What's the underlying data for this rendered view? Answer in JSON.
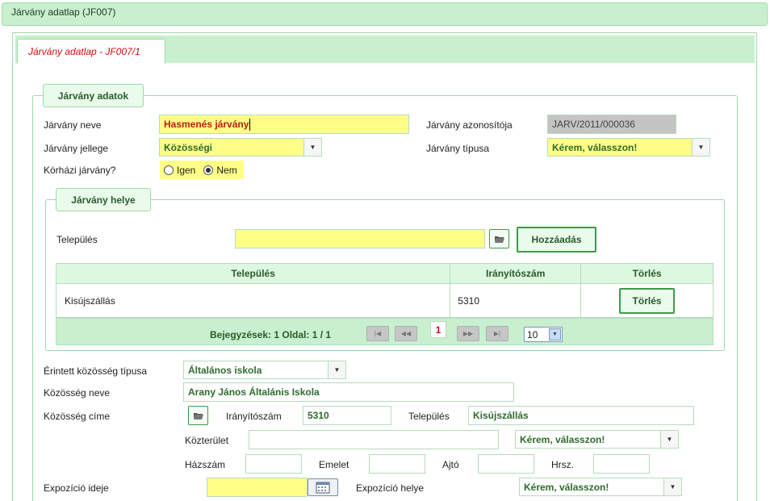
{
  "window_title": "Járvány adatlap (JF007)",
  "tab": {
    "label": "Járvány adatlap - JF007/1"
  },
  "section_main": {
    "legend": "Járvány adatok",
    "name_label": "Járvány neve",
    "name_value": "Hasmenés járvány",
    "id_label": "Járvány azonosítója",
    "id_value": "JARV/2011/000036",
    "character_label": "Járvány jellege",
    "character_value": "Közösségi",
    "type_label": "Járvány típusa",
    "type_value": "Kérem, válasszon!",
    "hospital_label": "Kórházi járvány?",
    "hospital_yes": "Igen",
    "hospital_no": "Nem",
    "hospital_selected": "Nem"
  },
  "section_location": {
    "legend": "Járvány helye",
    "settlement_label": "Település",
    "settlement_value": "",
    "add_button": "Hozzáadás",
    "table": {
      "headers": [
        "Település",
        "Irányítószám",
        "Törlés"
      ],
      "rows": [
        {
          "settlement": "Kisújszállás",
          "zip": "5310",
          "delete": "Törlés"
        }
      ]
    },
    "pager": {
      "info": "Bejegyzések: 1 Oldal: 1 / 1",
      "current_page": "1",
      "page_size": "10"
    }
  },
  "community": {
    "type_label": "Érintett közösség típusa",
    "type_value": "Általános iskola",
    "name_label": "Közösség neve",
    "name_value": "Arany János Általánis Iskola",
    "address_label": "Közösség címe",
    "zip_label": "Irányítószám",
    "zip_value": "5310",
    "city_label": "Település",
    "city_value": "Kisújszállás",
    "street_label": "Közterület",
    "street_value": "",
    "street_type_value": "Kérem, válasszon!",
    "house_label": "Házszám",
    "floor_label": "Emelet",
    "door_label": "Ajtó",
    "lot_label": "Hrsz."
  },
  "exposure": {
    "time_label": "Expozíció ideje",
    "time_value": "",
    "place_label": "Expozíció helye",
    "place_value": "Kérem, válasszon!"
  }
}
